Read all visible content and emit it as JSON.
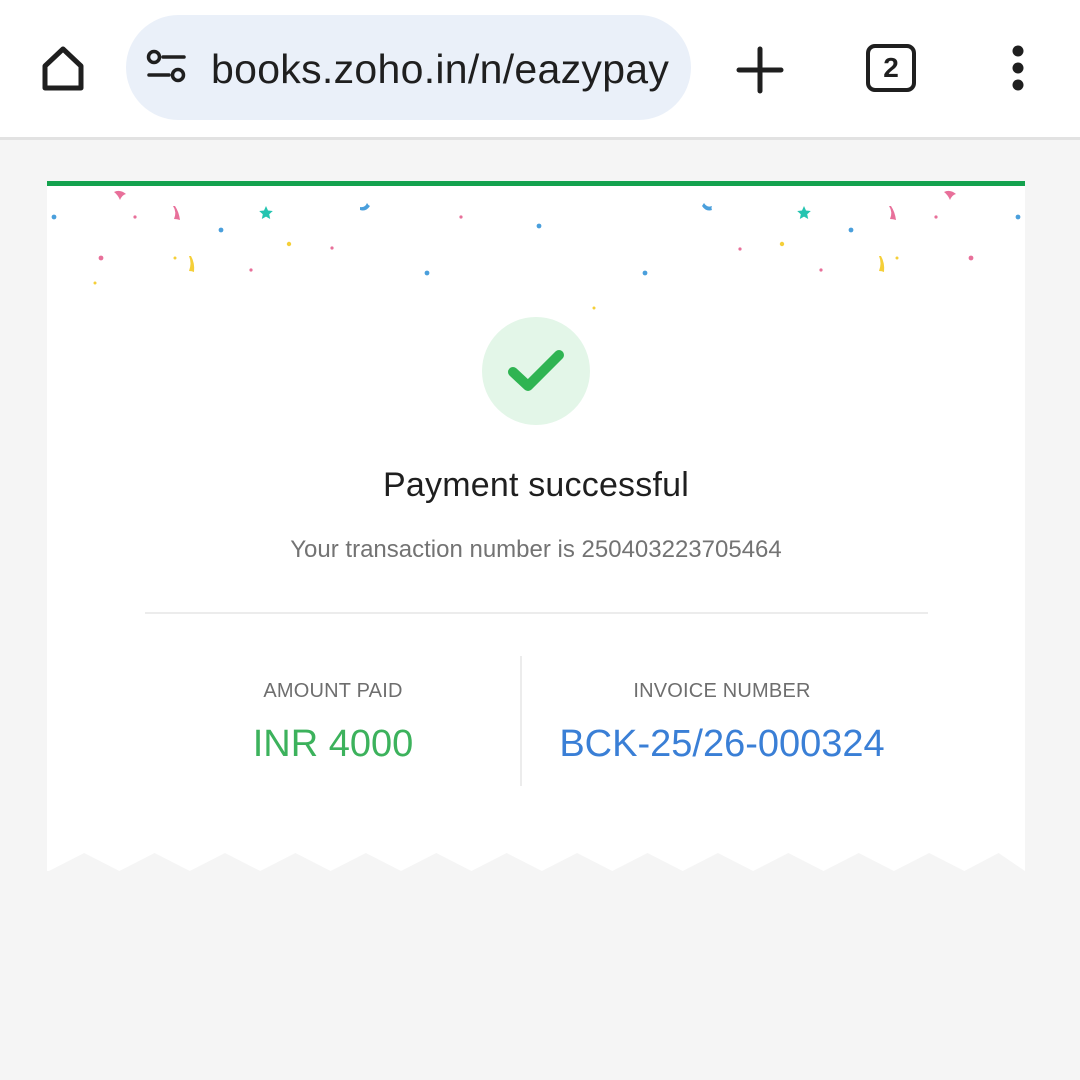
{
  "browser": {
    "url": "books.zoho.in/n/eazypay",
    "tab_count": "2",
    "icons": {
      "home": "home-icon",
      "site_settings": "tune-icon",
      "new_tab": "plus-icon",
      "tabs": "tab-switcher-icon",
      "menu": "more-vert-icon"
    }
  },
  "receipt": {
    "status_icon": "check-icon",
    "title": "Payment successful",
    "transaction_text": "Your transaction number is 250403223705464",
    "amount_label": "AMOUNT PAID",
    "amount_value": "INR 4000",
    "invoice_label": "INVOICE NUMBER",
    "invoice_value": "BCK-25/26-000324"
  },
  "colors": {
    "accent_green": "#14a24e",
    "amount_green": "#3cb25c",
    "invoice_blue": "#3a7fd6",
    "check_bg": "#e3f6e8",
    "url_bar_bg": "#eaf0f9"
  }
}
